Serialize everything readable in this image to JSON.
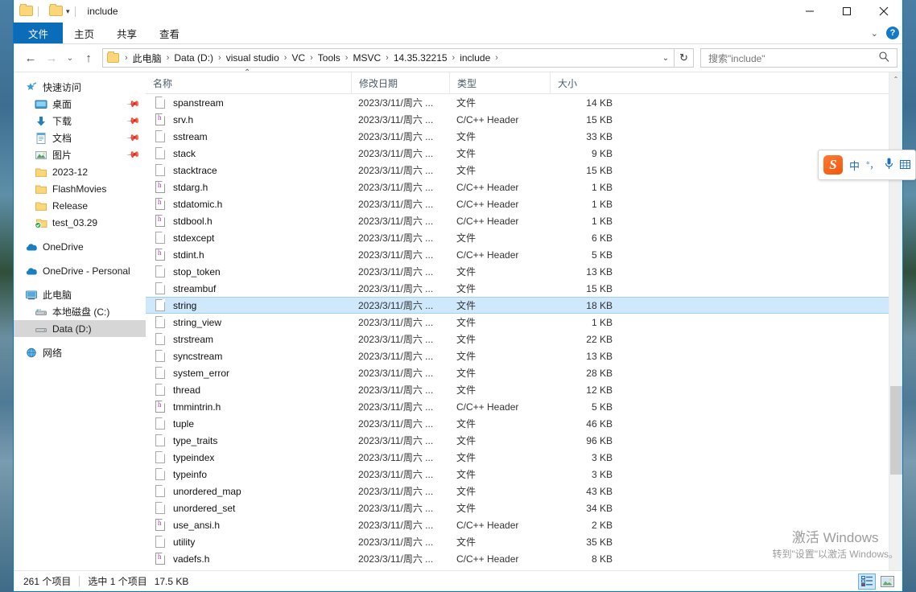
{
  "titlebar": {
    "title": "include",
    "minimize": "─",
    "maximize": "□",
    "close": "✕",
    "quick_access_caret": "▾"
  },
  "ribbon": {
    "tabs": [
      {
        "label": "文件",
        "active": true
      },
      {
        "label": "主页",
        "active": false
      },
      {
        "label": "共享",
        "active": false
      },
      {
        "label": "查看",
        "active": false
      }
    ],
    "collapse_caret": "⌄",
    "help_label": "?"
  },
  "addressbar": {
    "back_icon": "←",
    "forward_icon": "→",
    "recent_icon": "⌄",
    "up_icon": "↑",
    "breadcrumbs": [
      "此电脑",
      "Data (D:)",
      "visual studio",
      "VC",
      "Tools",
      "MSVC",
      "14.35.32215",
      "include"
    ],
    "separator": "›",
    "dropdown_icon": "⌄",
    "refresh_icon": "↻",
    "search_placeholder": "搜索\"include\"",
    "search_value": "",
    "search_icon": "⌕"
  },
  "navpane": {
    "groups": [
      {
        "header": {
          "label": "快速访问",
          "icon": "star-pin-icon",
          "indent": 14
        },
        "items": [
          {
            "label": "桌面",
            "icon": "desktop-icon",
            "pinned": true,
            "indent": 26
          },
          {
            "label": "下载",
            "icon": "download-icon",
            "pinned": true,
            "indent": 26
          },
          {
            "label": "文档",
            "icon": "documents-icon",
            "pinned": true,
            "indent": 26
          },
          {
            "label": "图片",
            "icon": "pictures-icon",
            "pinned": true,
            "indent": 26
          },
          {
            "label": "2023-12",
            "icon": "folder-icon",
            "pinned": false,
            "indent": 26
          },
          {
            "label": "FlashMovies",
            "icon": "folder-icon",
            "pinned": false,
            "indent": 26
          },
          {
            "label": "Release",
            "icon": "folder-icon",
            "pinned": false,
            "indent": 26
          },
          {
            "label": "test_03.29",
            "icon": "folder-synced-icon",
            "pinned": false,
            "indent": 26
          }
        ]
      },
      {
        "header": null,
        "items": [
          {
            "label": "OneDrive",
            "icon": "onedrive-icon",
            "pinned": false,
            "indent": 14
          }
        ]
      },
      {
        "header": null,
        "items": [
          {
            "label": "OneDrive - Personal",
            "icon": "onedrive-icon",
            "pinned": false,
            "indent": 14
          }
        ]
      },
      {
        "header": null,
        "items": [
          {
            "label": "此电脑",
            "icon": "computer-icon",
            "pinned": false,
            "indent": 14
          },
          {
            "label": "本地磁盘 (C:)",
            "icon": "drive-icon",
            "pinned": false,
            "indent": 26
          },
          {
            "label": "Data (D:)",
            "icon": "drive-icon",
            "pinned": false,
            "indent": 26,
            "selected": true
          }
        ]
      },
      {
        "header": null,
        "items": [
          {
            "label": "网络",
            "icon": "network-icon",
            "pinned": false,
            "indent": 14
          }
        ]
      }
    ]
  },
  "filelist": {
    "columns": [
      {
        "key": "name",
        "label": "名称",
        "sorted": "asc"
      },
      {
        "key": "date",
        "label": "修改日期"
      },
      {
        "key": "type",
        "label": "类型"
      },
      {
        "key": "size",
        "label": "大小"
      }
    ],
    "sort_caret": "⌃",
    "rows": [
      {
        "name": "spanstream",
        "date": "2023/3/11/周六 ...",
        "type": "文件",
        "size": "14 KB",
        "icon": "file-icon",
        "selected": false
      },
      {
        "name": "srv.h",
        "date": "2023/3/11/周六 ...",
        "type": "C/C++ Header",
        "size": "15 KB",
        "icon": "header-file-icon",
        "selected": false
      },
      {
        "name": "sstream",
        "date": "2023/3/11/周六 ...",
        "type": "文件",
        "size": "33 KB",
        "icon": "file-icon",
        "selected": false
      },
      {
        "name": "stack",
        "date": "2023/3/11/周六 ...",
        "type": "文件",
        "size": "9 KB",
        "icon": "file-icon",
        "selected": false
      },
      {
        "name": "stacktrace",
        "date": "2023/3/11/周六 ...",
        "type": "文件",
        "size": "15 KB",
        "icon": "file-icon",
        "selected": false
      },
      {
        "name": "stdarg.h",
        "date": "2023/3/11/周六 ...",
        "type": "C/C++ Header",
        "size": "1 KB",
        "icon": "header-file-icon",
        "selected": false
      },
      {
        "name": "stdatomic.h",
        "date": "2023/3/11/周六 ...",
        "type": "C/C++ Header",
        "size": "1 KB",
        "icon": "header-file-icon",
        "selected": false
      },
      {
        "name": "stdbool.h",
        "date": "2023/3/11/周六 ...",
        "type": "C/C++ Header",
        "size": "1 KB",
        "icon": "header-file-icon",
        "selected": false
      },
      {
        "name": "stdexcept",
        "date": "2023/3/11/周六 ...",
        "type": "文件",
        "size": "6 KB",
        "icon": "file-icon",
        "selected": false
      },
      {
        "name": "stdint.h",
        "date": "2023/3/11/周六 ...",
        "type": "C/C++ Header",
        "size": "5 KB",
        "icon": "header-file-icon",
        "selected": false
      },
      {
        "name": "stop_token",
        "date": "2023/3/11/周六 ...",
        "type": "文件",
        "size": "13 KB",
        "icon": "file-icon",
        "selected": false
      },
      {
        "name": "streambuf",
        "date": "2023/3/11/周六 ...",
        "type": "文件",
        "size": "15 KB",
        "icon": "file-icon",
        "selected": false
      },
      {
        "name": "string",
        "date": "2023/3/11/周六 ...",
        "type": "文件",
        "size": "18 KB",
        "icon": "file-icon",
        "selected": true
      },
      {
        "name": "string_view",
        "date": "2023/3/11/周六 ...",
        "type": "文件",
        "size": "1 KB",
        "icon": "file-icon",
        "selected": false
      },
      {
        "name": "strstream",
        "date": "2023/3/11/周六 ...",
        "type": "文件",
        "size": "22 KB",
        "icon": "file-icon",
        "selected": false
      },
      {
        "name": "syncstream",
        "date": "2023/3/11/周六 ...",
        "type": "文件",
        "size": "13 KB",
        "icon": "file-icon",
        "selected": false
      },
      {
        "name": "system_error",
        "date": "2023/3/11/周六 ...",
        "type": "文件",
        "size": "28 KB",
        "icon": "file-icon",
        "selected": false
      },
      {
        "name": "thread",
        "date": "2023/3/11/周六 ...",
        "type": "文件",
        "size": "12 KB",
        "icon": "file-icon",
        "selected": false
      },
      {
        "name": "tmmintrin.h",
        "date": "2023/3/11/周六 ...",
        "type": "C/C++ Header",
        "size": "5 KB",
        "icon": "header-file-icon",
        "selected": false
      },
      {
        "name": "tuple",
        "date": "2023/3/11/周六 ...",
        "type": "文件",
        "size": "46 KB",
        "icon": "file-icon",
        "selected": false
      },
      {
        "name": "type_traits",
        "date": "2023/3/11/周六 ...",
        "type": "文件",
        "size": "96 KB",
        "icon": "file-icon",
        "selected": false
      },
      {
        "name": "typeindex",
        "date": "2023/3/11/周六 ...",
        "type": "文件",
        "size": "3 KB",
        "icon": "file-icon",
        "selected": false
      },
      {
        "name": "typeinfo",
        "date": "2023/3/11/周六 ...",
        "type": "文件",
        "size": "3 KB",
        "icon": "file-icon",
        "selected": false
      },
      {
        "name": "unordered_map",
        "date": "2023/3/11/周六 ...",
        "type": "文件",
        "size": "43 KB",
        "icon": "file-icon",
        "selected": false
      },
      {
        "name": "unordered_set",
        "date": "2023/3/11/周六 ...",
        "type": "文件",
        "size": "34 KB",
        "icon": "file-icon",
        "selected": false
      },
      {
        "name": "use_ansi.h",
        "date": "2023/3/11/周六 ...",
        "type": "C/C++ Header",
        "size": "2 KB",
        "icon": "header-file-icon",
        "selected": false
      },
      {
        "name": "utility",
        "date": "2023/3/11/周六 ...",
        "type": "文件",
        "size": "35 KB",
        "icon": "file-icon",
        "selected": false
      },
      {
        "name": "vadefs.h",
        "date": "2023/3/11/周六 ...",
        "type": "C/C++ Header",
        "size": "8 KB",
        "icon": "header-file-icon",
        "selected": false
      }
    ],
    "scroll": {
      "up_arrow": "⌃",
      "down_arrow": "⌄"
    }
  },
  "statusbar": {
    "item_count": "261 个项目",
    "selected_text": "选中 1 个项目",
    "selected_size": "17.5 KB",
    "view_details": "details-view-icon",
    "view_large": "large-icons-view-icon"
  },
  "ime": {
    "logo": "S",
    "mode": "中",
    "punct": "°，",
    "mic": "🎙",
    "keyboard": "⌨"
  },
  "watermark": {
    "line1": "激活 Windows",
    "line2": "转到\"设置\"以激活 Windows。"
  },
  "colors": {
    "accent": "#0078d7",
    "file_tab": "#0b6cb8",
    "selection": "#cfe8fb",
    "nav_selection": "#d6d6d6",
    "header_text": "#4a5b6b"
  }
}
